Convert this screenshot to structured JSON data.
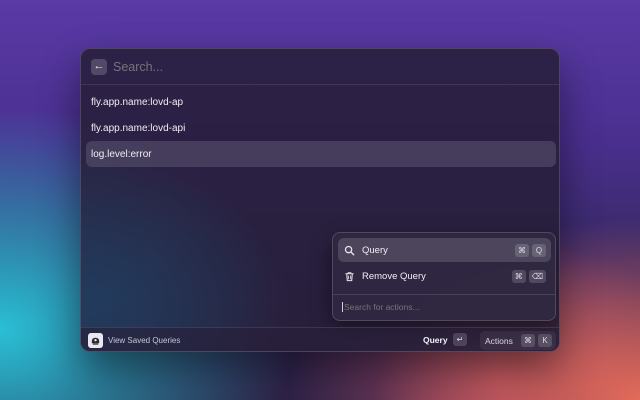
{
  "search": {
    "placeholder": "Search...",
    "back_icon": "arrow-left-icon"
  },
  "results": [
    {
      "label": "fly.app.name:lovd-ap",
      "selected": false
    },
    {
      "label": "fly.app.name:lovd-api",
      "selected": false
    },
    {
      "label": "log.level:error",
      "selected": true
    }
  ],
  "actions_panel": {
    "items": [
      {
        "label": "Query",
        "icon": "search-icon",
        "keys": [
          "⌘",
          "Q"
        ],
        "selected": true
      },
      {
        "label": "Remove Query",
        "icon": "trash-icon",
        "keys": [
          "⌘",
          "⌫"
        ],
        "selected": false
      }
    ],
    "search_placeholder": "Search for actions..."
  },
  "footer": {
    "label": "View Saved Queries",
    "primary_action": "Query",
    "primary_key": "↵",
    "actions_label": "Actions",
    "actions_keys": [
      "⌘",
      "K"
    ]
  },
  "colors": {
    "selection": "#3f3750",
    "panel": "#261e38",
    "text": "#ecebf2"
  }
}
